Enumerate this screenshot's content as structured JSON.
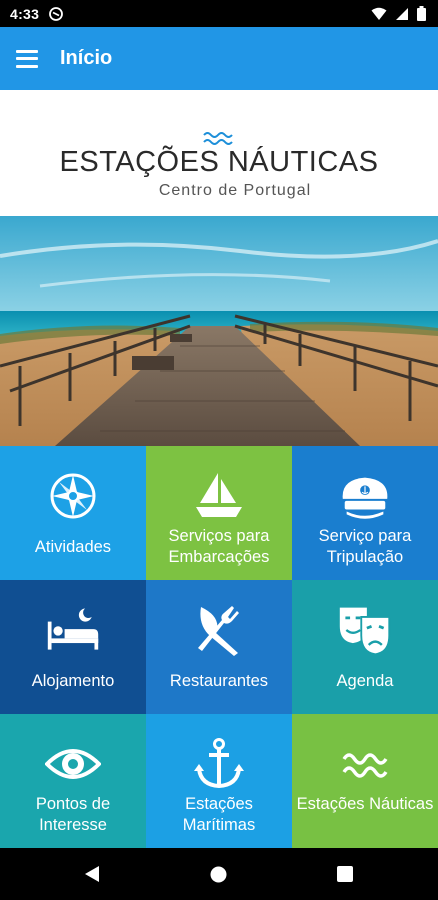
{
  "status_bar": {
    "time": "4:33"
  },
  "app_bar": {
    "title": "Início"
  },
  "logo": {
    "title": "ESTAÇÕES NÁUTICAS",
    "subtitle": "Centro de Portugal"
  },
  "tiles": [
    {
      "label": "Atividades",
      "color": "#1da1e6",
      "icon": "compass-icon"
    },
    {
      "label": "Serviços para Embarcações",
      "color": "#7dc242",
      "icon": "sailboat-icon"
    },
    {
      "label": "Serviço para Tripulação",
      "color": "#1a7ecf",
      "icon": "captain-hat-icon"
    },
    {
      "label": "Alojamento",
      "color": "#104f92",
      "icon": "bed-icon"
    },
    {
      "label": "Restaurantes",
      "color": "#1e78c8",
      "icon": "fork-knife-icon"
    },
    {
      "label": "Agenda",
      "color": "#1a9fa9",
      "icon": "theater-masks-icon"
    },
    {
      "label": "Pontos de Interesse",
      "color": "#1aa6ad",
      "icon": "eye-icon"
    },
    {
      "label": "Estações Marítimas",
      "color": "#1ca0e4",
      "icon": "anchor-icon"
    },
    {
      "label": "Estações Náuticas",
      "color": "#78c143",
      "icon": "waves-icon"
    }
  ]
}
